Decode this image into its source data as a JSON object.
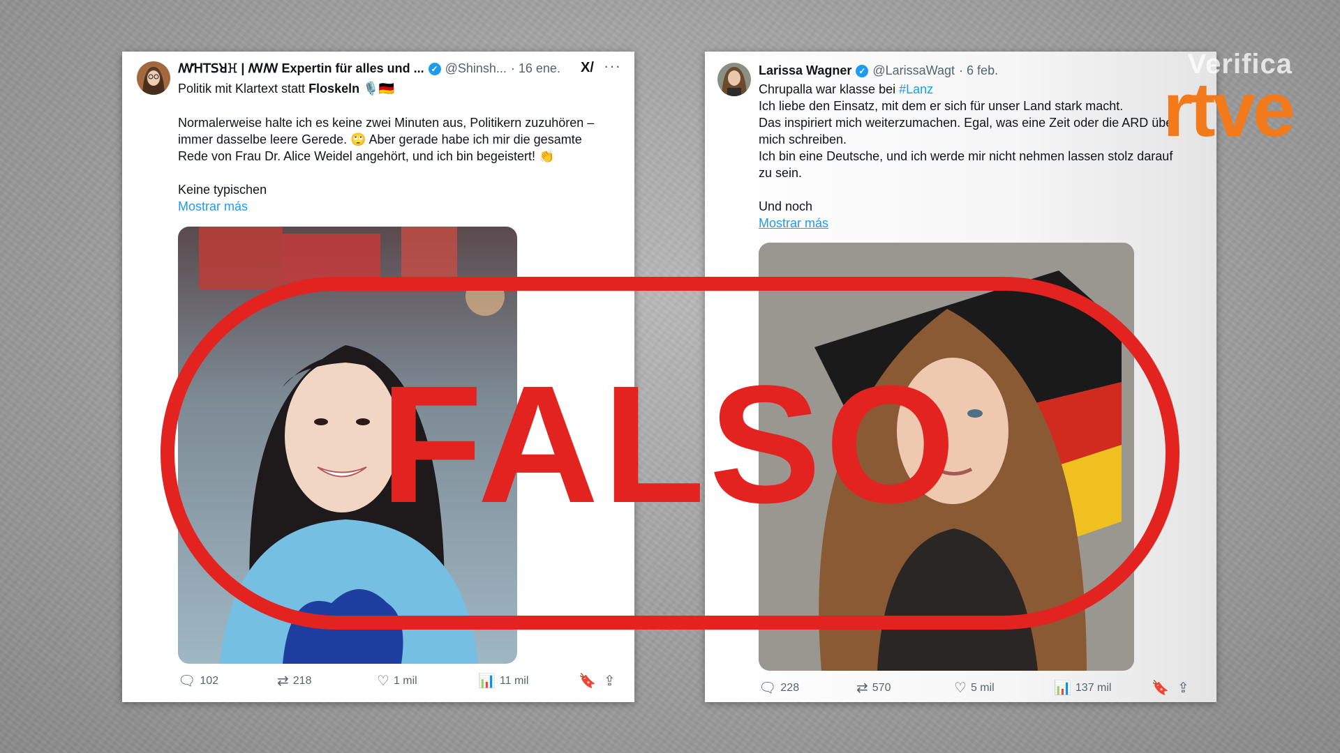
{
  "colors": {
    "stamp_red": "#e32320",
    "link_blue": "#1d9bf0",
    "rtve_orange": "#f27a1a"
  },
  "tweet_left": {
    "name": "ꟿꞪꓔꓢꓤꖾ | ꟿꟿ Expertin für alles und ...",
    "handle": "@Shinsh...",
    "date": "· 16 ene.",
    "bio_before": "Politik mit Klartext statt ",
    "bio_bold": "Floskeln",
    "bio_emoji": "🎙️🇩🇪",
    "text_lines": [
      "Normalerweise halte ich es keine zwei Minuten aus, Politikern zuzuhören –",
      "immer dasselbe leere Gerede. 🙄 Aber gerade habe ich mir die gesamte",
      "Rede von Frau Dr. Alice Weidel angehört, und ich bin begeistert! 👏"
    ],
    "text_tail": "Keine typischen",
    "show_more": "Mostrar más",
    "replies": "102",
    "retweets": "218",
    "likes": "1 mil",
    "views": "11 mil"
  },
  "tweet_right": {
    "name": "Larissa Wagner",
    "handle": "@LarissaWagt",
    "date": "· 6 feb.",
    "line1_before": "Chrupalla war klasse bei ",
    "line1_hashtag": "#Lanz",
    "text_lines": [
      "Ich liebe den Einsatz, mit dem er sich für unser Land stark macht.",
      "Das inspiriert mich weiterzumachen. Egal, was eine Zeit oder die ARD über",
      "mich schreiben.",
      "Ich bin eine Deutsche, und ich werde mir nicht nehmen lassen stolz darauf",
      "zu sein."
    ],
    "text_tail": "Und noch",
    "show_more": "Mostrar más",
    "replies": "228",
    "retweets": "570",
    "likes": "5 mil",
    "views": "137 mil"
  },
  "stamp": {
    "label": "FALSO"
  },
  "logo": {
    "top": "Verifica",
    "brand": "rtve"
  },
  "icons": [
    "verified-badge-icon",
    "grok-icon",
    "more-icon",
    "reply-icon",
    "retweet-icon",
    "like-icon",
    "views-icon",
    "bookmark-icon",
    "share-icon"
  ]
}
